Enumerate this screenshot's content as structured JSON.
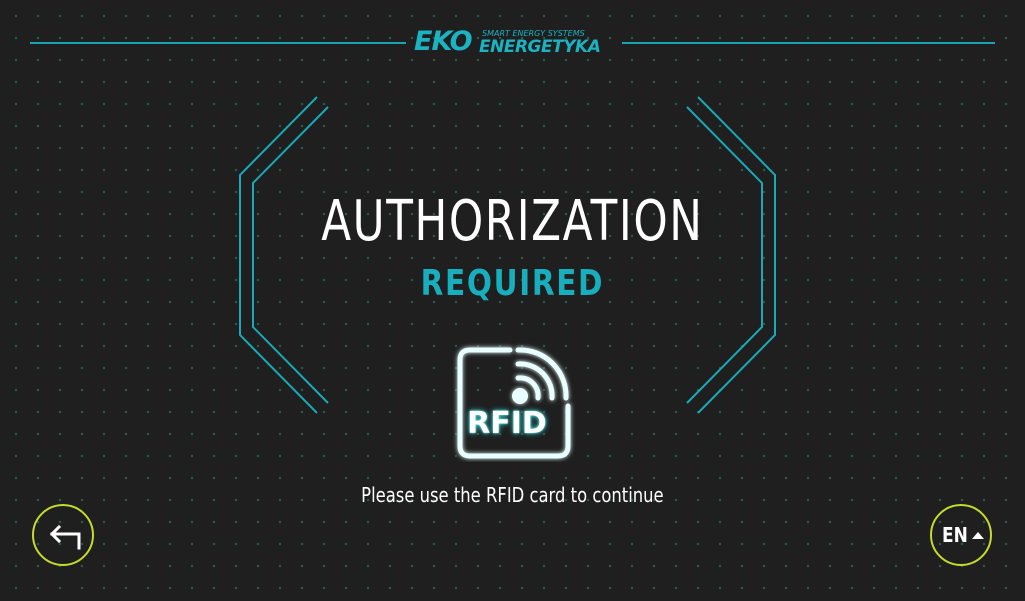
{
  "header": {
    "logo_eko": "EKO",
    "logo_tagline": "SMART ENERGY SYSTEMS",
    "logo_brand": "ENERGETYKA"
  },
  "main": {
    "title": "AUTHORIZATION",
    "subtitle": "REQUIRED",
    "rfid_label": "RFID",
    "instruction": "Please use the RFID card to continue"
  },
  "controls": {
    "back_icon": "return-arrow-icon",
    "language_label": "EN",
    "language_icon": "caret-up-icon"
  },
  "colors": {
    "background": "#1f1f1f",
    "accent_teal": "#19aebd",
    "button_ring": "#c4db29",
    "text": "#ffffff"
  }
}
